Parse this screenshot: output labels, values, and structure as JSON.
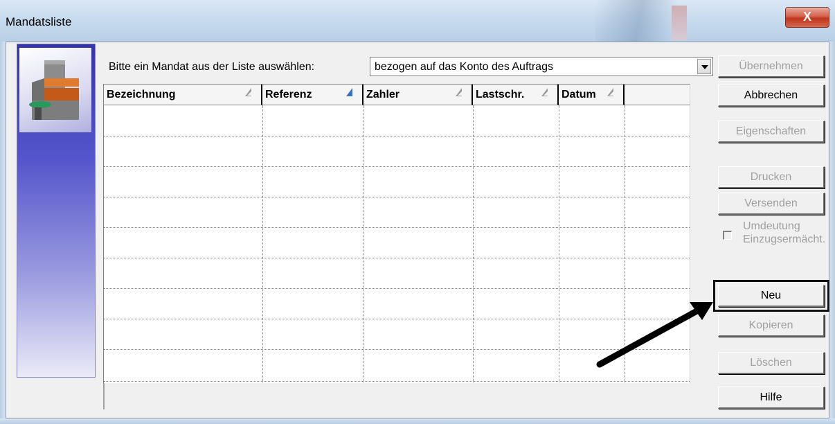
{
  "window": {
    "title": "Mandatsliste",
    "close_glyph": "X"
  },
  "instruction": "Bitte ein Mandat aus der Liste auswählen:",
  "filter": {
    "selected": "bezogen auf das Konto des Auftrags"
  },
  "table": {
    "columns": [
      {
        "label": "Bezeichnung",
        "sort_icon": "sort-icon-outline"
      },
      {
        "label": "Referenz",
        "sort_icon": "sort-icon-filled"
      },
      {
        "label": "Zahler",
        "sort_icon": "sort-icon-outline"
      },
      {
        "label": "Lastschr.",
        "sort_icon": "sort-icon-outline"
      },
      {
        "label": "Datum",
        "sort_icon": "sort-icon-outline"
      },
      {
        "label": "",
        "sort_icon": ""
      }
    ],
    "rows": []
  },
  "buttons": {
    "uebernehmen": "Übernehmen",
    "abbrechen": "Abbrechen",
    "eigenschaften": "Eigenschaften",
    "drucken": "Drucken",
    "versenden": "Versenden",
    "neu": "Neu",
    "kopieren": "Kopieren",
    "loeschen": "Löschen",
    "hilfe": "Hilfe"
  },
  "checkbox": {
    "label": "Umdeutung Einzugsermächt.",
    "checked": false
  },
  "colors": {
    "close_button": "#c1361d",
    "banner_top": "#3333aa",
    "disabled_text": "#a0a0a0",
    "annotation": "#000000"
  }
}
